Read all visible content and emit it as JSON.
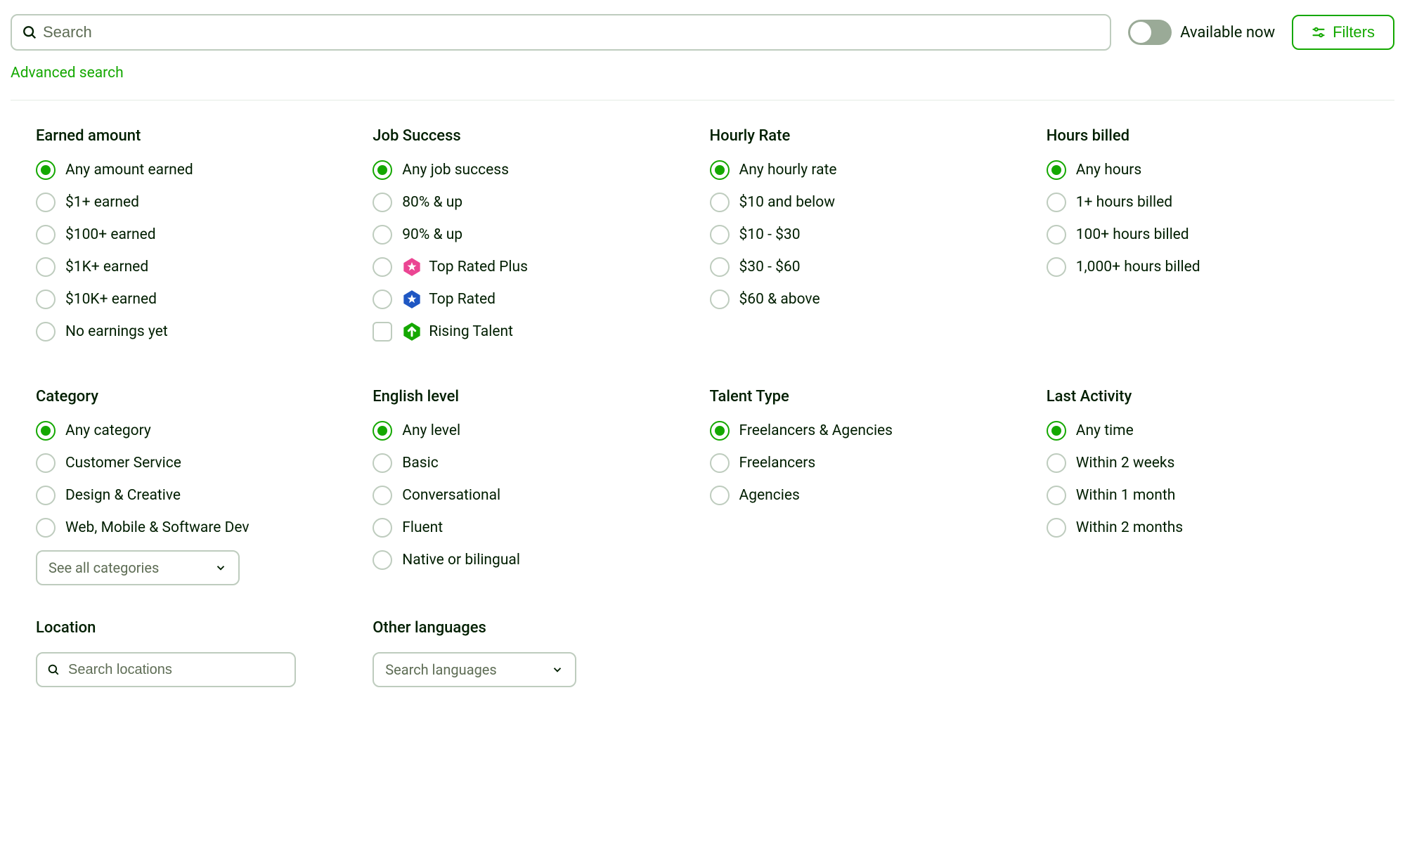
{
  "search": {
    "placeholder": "Search"
  },
  "advanced_search": "Advanced search",
  "available_now": "Available now",
  "filters_button": "Filters",
  "groups": {
    "earned": {
      "title": "Earned amount",
      "opts": [
        "Any amount earned",
        "$1+ earned",
        "$100+ earned",
        "$1K+ earned",
        "$10K+ earned",
        "No earnings yet"
      ]
    },
    "job_success": {
      "title": "Job Success",
      "opts": [
        "Any job success",
        "80% & up",
        "90% & up",
        "Top Rated Plus",
        "Top Rated",
        "Rising Talent"
      ]
    },
    "hourly_rate": {
      "title": "Hourly Rate",
      "opts": [
        "Any hourly rate",
        "$10 and below",
        "$10 - $30",
        "$30 - $60",
        "$60 & above"
      ]
    },
    "hours_billed": {
      "title": "Hours billed",
      "opts": [
        "Any hours",
        "1+ hours billed",
        "100+ hours billed",
        "1,000+ hours billed"
      ]
    },
    "category": {
      "title": "Category",
      "opts": [
        "Any category",
        "Customer Service",
        "Design & Creative",
        "Web, Mobile & Software Dev"
      ],
      "see_all": "See all categories"
    },
    "english": {
      "title": "English level",
      "opts": [
        "Any level",
        "Basic",
        "Conversational",
        "Fluent",
        "Native or bilingual"
      ]
    },
    "talent_type": {
      "title": "Talent Type",
      "opts": [
        "Freelancers & Agencies",
        "Freelancers",
        "Agencies"
      ]
    },
    "last_activity": {
      "title": "Last Activity",
      "opts": [
        "Any time",
        "Within 2 weeks",
        "Within 1 month",
        "Within 2 months"
      ]
    },
    "location": {
      "title": "Location",
      "placeholder": "Search locations"
    },
    "other_languages": {
      "title": "Other languages",
      "placeholder": "Search languages"
    }
  }
}
